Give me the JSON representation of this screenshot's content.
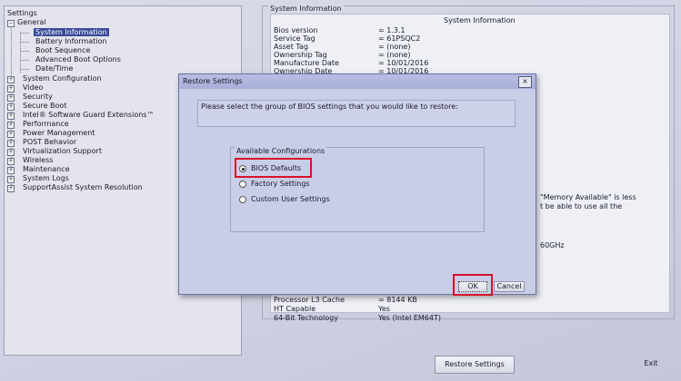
{
  "tree": {
    "title": "Settings",
    "general": {
      "label": "General",
      "children": [
        "System Information",
        "Battery Information",
        "Boot Sequence",
        "Advanced Boot Options",
        "Date/Time"
      ]
    },
    "items": [
      "System Configuration",
      "Video",
      "Security",
      "Secure Boot",
      "Intel® Software Guard Extensions™",
      "Performance",
      "Power Management",
      "POST Behavior",
      "Virtualization Support",
      "Wireless",
      "Maintenance",
      "System Logs",
      "SupportAssist System Resolution"
    ]
  },
  "sysinfo": {
    "group_title": "System Information",
    "box_title": "System Information",
    "rows": [
      {
        "label": "Bios version",
        "value": "= 1.3.1"
      },
      {
        "label": "Service Tag",
        "value": "= 61PSQC2"
      },
      {
        "label": "Asset Tag",
        "value": "= (none)"
      },
      {
        "label": "Ownership Tag",
        "value": "= (none)"
      },
      {
        "label": "Manufacture Date",
        "value": "= 10/01/2016"
      },
      {
        "label": "Ownership Date",
        "value": "= 10/01/2016"
      }
    ],
    "partial_1": "\"Memory Available\" is less",
    "partial_2": "t be able to use all the",
    "partial_3": "60GHz",
    "bottom_rows": [
      {
        "label": "Processor L3 Cache",
        "value": "= 8144 KB"
      },
      {
        "label": "HT Capable",
        "value": "Yes"
      },
      {
        "label": "64-Bit Technology",
        "value": "Yes (Intel EM64T)"
      }
    ]
  },
  "footer": {
    "restore_label": "Restore Settings",
    "exit_label": "Exit"
  },
  "dialog": {
    "title": "Restore Settings",
    "close": "×",
    "prompt": "Please select the group of BIOS settings that you would like to restore:",
    "group_label": "Available Configurations",
    "options": [
      "BIOS Defaults",
      "Factory Settings",
      "Custom User Settings"
    ],
    "selected": "BIOS Defaults",
    "ok": "OK",
    "cancel": "Cancel"
  },
  "colors": {
    "highlight": "#d8132b",
    "selection": "#3a4a9a"
  }
}
